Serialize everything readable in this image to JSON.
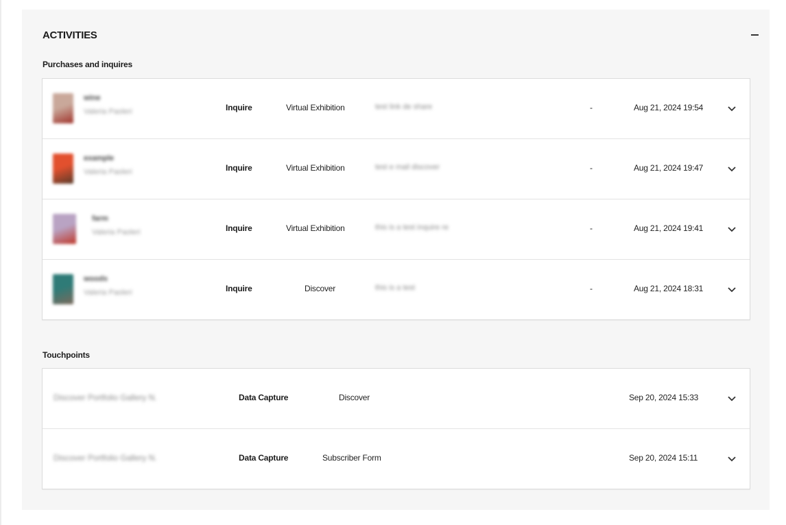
{
  "activities": {
    "title": "ACTIVITIES",
    "collapse_icon": "minus-icon"
  },
  "purchases": {
    "label": "Purchases and inquires",
    "rows": [
      {
        "thumb_colors": [
          "#c9a89a",
          "#a1352d"
        ],
        "title": "wine",
        "subtitle": "Valeria Paoleri",
        "type": "Inquire",
        "source": "Virtual Exhibition",
        "message": "test link de share",
        "amount": "-",
        "date": "Aug 21, 2024 19:54"
      },
      {
        "thumb_colors": [
          "#e2502e",
          "#5b3b2a"
        ],
        "title": "example",
        "subtitle": "Valeria Paoleri",
        "type": "Inquire",
        "source": "Virtual Exhibition",
        "message": "test e mail discover",
        "amount": "-",
        "date": "Aug 21, 2024 19:47"
      },
      {
        "thumb_colors": [
          "#b9a3c3",
          "#c0392b"
        ],
        "title": "farm",
        "subtitle": "Valeria Paoleri",
        "type": "Inquire",
        "source": "Virtual Exhibition",
        "message": "this is a test inquire re",
        "amount": "-",
        "date": "Aug 21, 2024 19:41"
      },
      {
        "thumb_colors": [
          "#2f7b77",
          "#7a6a5c"
        ],
        "title": "woods",
        "subtitle": "Valeria Paoleri",
        "type": "Inquire",
        "source": "Discover",
        "message": "this is a test",
        "amount": "-",
        "date": "Aug 21, 2024 18:31"
      }
    ]
  },
  "touchpoints": {
    "label": "Touchpoints",
    "rows": [
      {
        "name": "Discover Portfolio Gallery N.",
        "type": "Data Capture",
        "source": "Discover",
        "date": "Sep 20, 2024 15:33"
      },
      {
        "name": "Discover Portfolio Gallery N.",
        "type": "Data Capture",
        "source": "Subscriber Form",
        "date": "Sep 20, 2024 15:11"
      }
    ]
  },
  "icons": {
    "expand": "chevron-down-icon"
  }
}
